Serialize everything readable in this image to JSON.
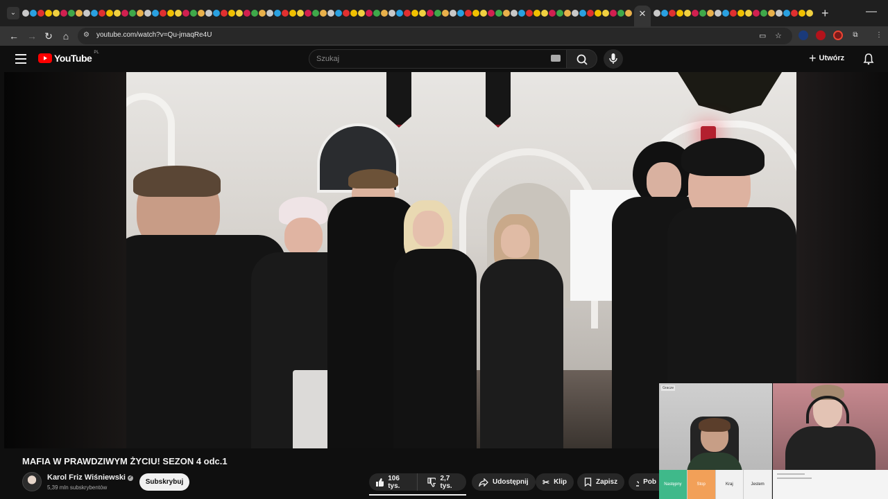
{
  "browser": {
    "url": "youtube.com/watch?v=Qu-jmaqRe4U",
    "tab_close": "✕",
    "new_tab": "+",
    "minimize": "—",
    "tab_menu": "⌄",
    "back": "←",
    "forward": "→",
    "reload": "↻",
    "home": "⌂",
    "site_info": "⚙",
    "cast": "▭",
    "bookmark": "☆",
    "extensions": "⧉",
    "menu": "⋮"
  },
  "header": {
    "logo_text": "YouTube",
    "country_code": "PL",
    "search_placeholder": "Szukaj",
    "create_label": "Utwórz",
    "create_plus": "+"
  },
  "video": {
    "title": "MAFIA W PRAWDZIWYM ŻYCIU! SEZON 4 odc.1"
  },
  "channel": {
    "name": "Karol Friz Wiśniewski",
    "verified_mark": "✓",
    "subscribers": "5,39 mln subskrybentów",
    "subscribe_label": "Subskrybuj"
  },
  "actions": {
    "likes": "106 tys.",
    "dislikes": "2,7 tys.",
    "share": "Udostępnij",
    "clip": "Klip",
    "save": "Zapisz",
    "download": "Pob"
  },
  "overlay": {
    "tag": "Gracze",
    "buttons": [
      "Następny",
      "Stop",
      "Kraj",
      "Jestem"
    ]
  },
  "colors": {
    "brand_red": "#ff0000",
    "background": "#0f0f0f",
    "pill": "#272727"
  }
}
